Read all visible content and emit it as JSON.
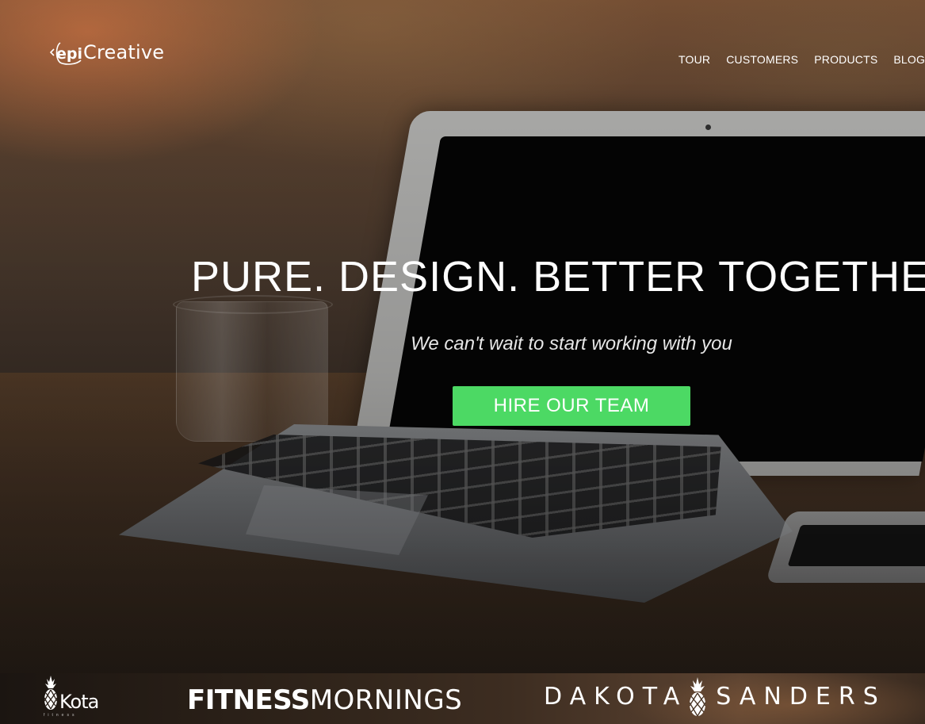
{
  "header": {
    "logo_text": "Creative",
    "logo_mark": "epi",
    "nav": [
      {
        "label": "TOUR"
      },
      {
        "label": "CUSTOMERS"
      },
      {
        "label": "PRODUCTS"
      },
      {
        "label": "BLOG"
      }
    ]
  },
  "hero": {
    "headline": "PURE. DESIGN. BETTER TOGETHER",
    "tagline": "We can't wait to start working with you",
    "cta_label": "HIRE OUR TEAM",
    "cta_color": "#4cd964"
  },
  "clients": {
    "kota": {
      "name": "Kota",
      "sub": "fitness",
      "icon": "pineapple-icon"
    },
    "fitness_bold": "FITNESS",
    "fitness_thin": "MORNINGS",
    "dakota_left": "DAKOTA",
    "dakota_right": "SANDERS",
    "dakota_icon": "pineapple-icon"
  }
}
